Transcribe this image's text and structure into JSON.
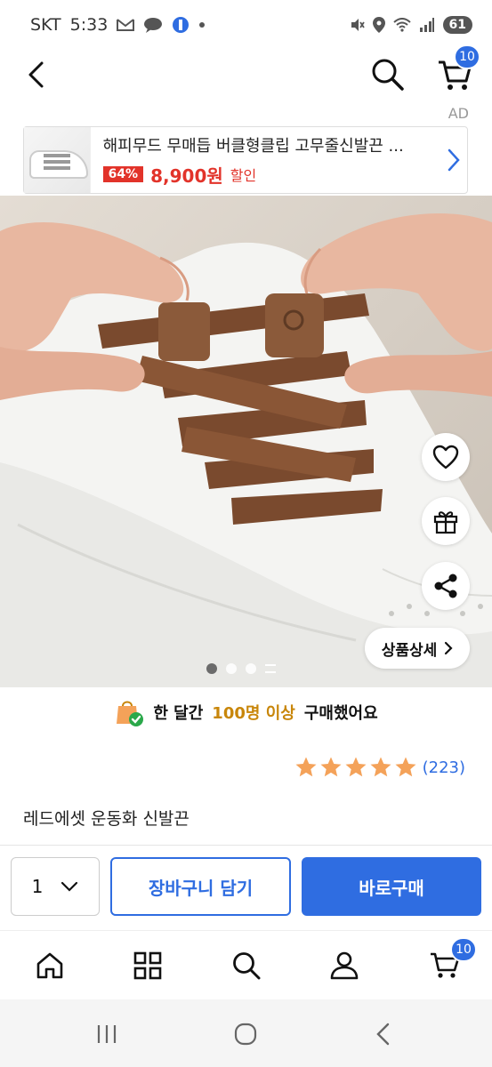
{
  "status_bar": {
    "carrier": "SKT",
    "time": "5:33",
    "battery": "61"
  },
  "header": {
    "cart_count": "10"
  },
  "ad": {
    "label": "AD",
    "title": "해피무드 무매듭 버클형클립 고무줄신발끈 ...",
    "discount": "64%",
    "price": "8,900원",
    "sale_label": "할인"
  },
  "product_image": {
    "detail_button": "상품상세",
    "slide_count": 3,
    "active_slide": 1
  },
  "purchase_notice": {
    "prefix": "한 달간",
    "highlight": "100명 이상",
    "suffix": "구매했어요"
  },
  "rating": {
    "stars": 5,
    "review_count": "(223)"
  },
  "product": {
    "name": "레드에셋 운동화 신발끈"
  },
  "buy_bar": {
    "quantity": "1",
    "add_to_cart": "장바구니 담기",
    "buy_now": "바로구매"
  },
  "bottom_nav": {
    "cart_count": "10"
  },
  "colors": {
    "accent": "#2f6de1",
    "sale": "#e2332a",
    "star": "#f4a259",
    "highlight": "#c8860a"
  }
}
